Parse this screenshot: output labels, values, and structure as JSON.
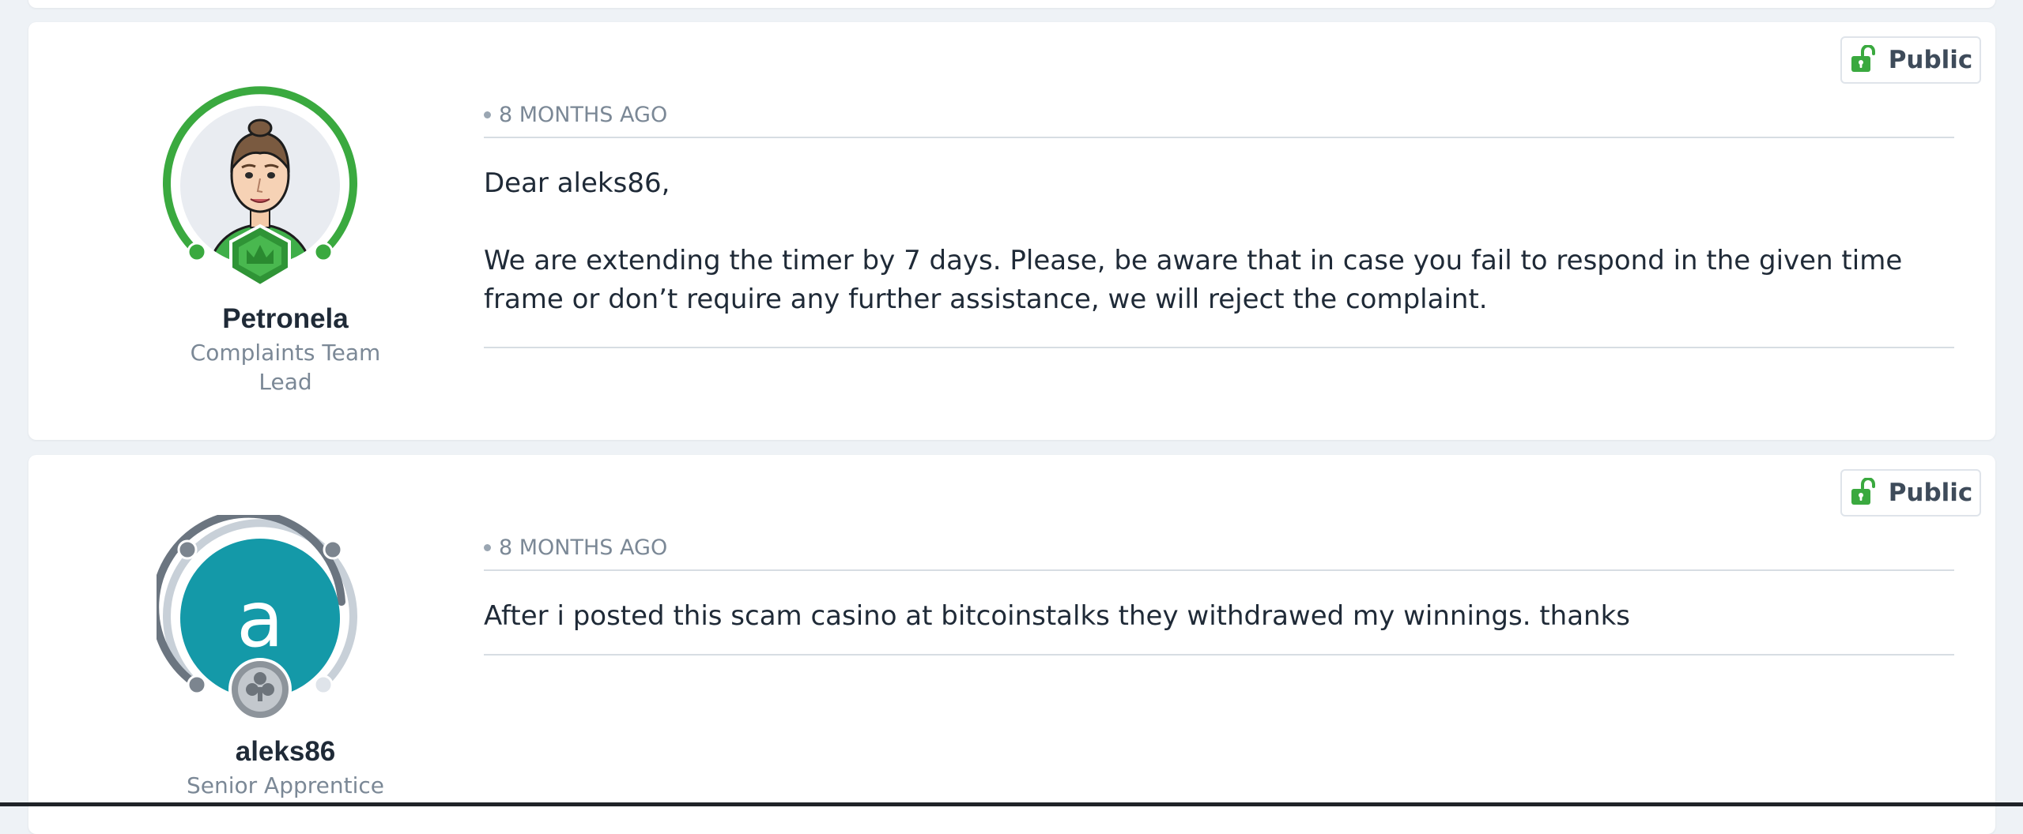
{
  "posts": [
    {
      "visibility": "Public",
      "author": {
        "name": "Petronela",
        "role": "Complaints Team Lead",
        "role_line1": "Complaints Team",
        "role_line2": "Lead",
        "avatar": "cartoon-avatar-icon",
        "ring_color": "#3aa93f",
        "badge": "crown-shield-icon"
      },
      "time": "8 MONTHS AGO",
      "paragraphs": [
        "Dear aleks86,",
        "We are extending the timer by 7 days. Please, be aware that in case you fail to respond in the given time frame or don’t require any further assistance, we will reject the complaint."
      ]
    },
    {
      "visibility": "Public",
      "author": {
        "name": "aleks86",
        "role": "Senior Apprentice",
        "avatar_letter": "a",
        "avatar_color": "#1499a8",
        "ring_color": "#6b7580",
        "badge": "club-coin-icon"
      },
      "time": "8 MONTHS AGO",
      "paragraphs": [
        "After i posted this scam casino at bitcoinstalks they withdrawed my winnings. thanks"
      ]
    }
  ],
  "colors": {
    "page_bg": "#eef2f6",
    "card_bg": "#ffffff",
    "accent_green": "#3aa93f",
    "text": "#1f2a37",
    "muted": "#7b8896"
  }
}
